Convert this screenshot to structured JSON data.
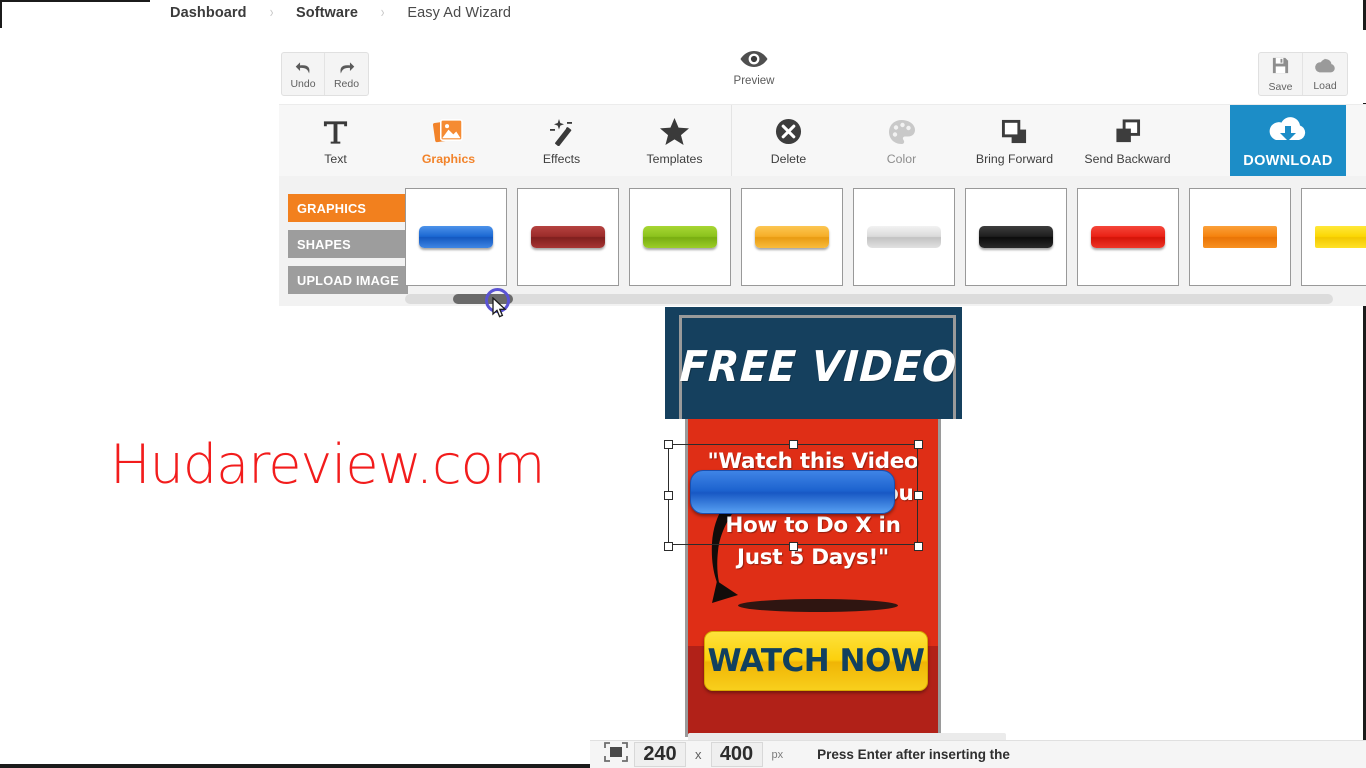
{
  "breadcrumb": {
    "items": [
      {
        "label": "Dashboard",
        "active": true
      },
      {
        "label": "Software",
        "active": true
      },
      {
        "label": "Easy Ad Wizard",
        "active": false
      }
    ],
    "separator": "›"
  },
  "upper_toolbar": {
    "undo_label": "Undo",
    "redo_label": "Redo",
    "preview_label": "Preview",
    "save_label": "Save",
    "load_label": "Load"
  },
  "main_toolbar": {
    "items": [
      {
        "label": "Text",
        "icon": "text-t-icon",
        "state": "normal"
      },
      {
        "label": "Graphics",
        "icon": "graphics-photos-icon",
        "state": "active"
      },
      {
        "label": "Effects",
        "icon": "magic-wand-icon",
        "state": "normal"
      },
      {
        "label": "Templates",
        "icon": "star-icon",
        "state": "normal"
      },
      {
        "label": "Delete",
        "icon": "delete-x-circle-icon",
        "state": "normal"
      },
      {
        "label": "Color",
        "icon": "color-palette-icon",
        "state": "disabled"
      },
      {
        "label": "Bring Forward",
        "icon": "bring-forward-icon",
        "state": "normal"
      },
      {
        "label": "Send Backward",
        "icon": "send-backward-icon",
        "state": "normal"
      }
    ],
    "download_label": "DOWNLOAD",
    "download_icon": "cloud-download-icon",
    "download_color": "#1c8dc7",
    "active_color": "#f2832a"
  },
  "palette": {
    "tabs": [
      {
        "label": "GRAPHICS",
        "active": true
      },
      {
        "label": "SHAPES",
        "active": false
      },
      {
        "label": "UPLOAD IMAGE",
        "active": false
      }
    ],
    "active_tab_color": "#f2801e",
    "inactive_tab_color": "#9d9d9d",
    "thumbnails": [
      {
        "name": "blue-button",
        "color": "#1c6fd8"
      },
      {
        "name": "darkred-button",
        "color": "#9e2d2b"
      },
      {
        "name": "green-button",
        "color": "#8cc421"
      },
      {
        "name": "orange-button",
        "color": "#f5ad2b"
      },
      {
        "name": "silver-button",
        "color": "#cccccc"
      },
      {
        "name": "black-button",
        "color": "#1a1a1a"
      },
      {
        "name": "red-button",
        "color": "#ec2418"
      },
      {
        "name": "orange2-button",
        "color": "#f58410"
      },
      {
        "name": "yellow-button",
        "color": "#fbd900"
      }
    ]
  },
  "watermark": {
    "text": "Hudareview.com",
    "color": "#f21c1c"
  },
  "ad": {
    "header_text": "FREE VIDEO",
    "header_bg": "#15405e",
    "body_bg": "#df2e16",
    "lines": [
      "\"Watch this Video",
      "and I'll Show You",
      "How to Do X in",
      "Just 5 Days!\""
    ],
    "cta_label": "WATCH NOW",
    "cta_bg": "#fcd00d",
    "cta_text_color": "#11405f",
    "selected_object": "blue-button"
  },
  "bottom_bar": {
    "width_value": "240",
    "x_label": "x",
    "height_value": "400",
    "unit_label": "px",
    "hint": "Press Enter after inserting the",
    "size_icon": "canvas-size-icon"
  }
}
